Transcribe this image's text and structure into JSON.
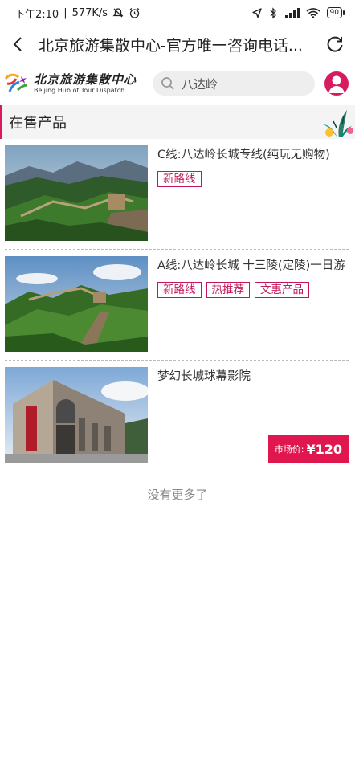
{
  "status": {
    "time": "下午2:10",
    "speed": "577K/s",
    "battery": "90"
  },
  "nav": {
    "title": "北京旅游集散中心-官方唯一咨询电话..."
  },
  "brand": {
    "name_cn": "北京旅游集散中心",
    "name_en": "Beijing Hub of Tour Dispatch"
  },
  "search": {
    "value": "八达岭"
  },
  "section": {
    "title": "在售产品"
  },
  "products": [
    {
      "title": "C线:八达岭长城专线(纯玩无购物)",
      "tags": [
        "新路线"
      ]
    },
    {
      "title": "A线:八达岭长城 十三陵(定陵)一日游",
      "tags": [
        "新路线",
        "热推荐",
        "文惠产品"
      ]
    },
    {
      "title": "梦幻长城球幕影院",
      "tags": [],
      "price_label": "市场价:",
      "price_value": "¥120"
    }
  ],
  "footer": {
    "no_more": "没有更多了"
  },
  "colors": {
    "accent": "#d81b60",
    "price_bg": "#e0174f"
  }
}
